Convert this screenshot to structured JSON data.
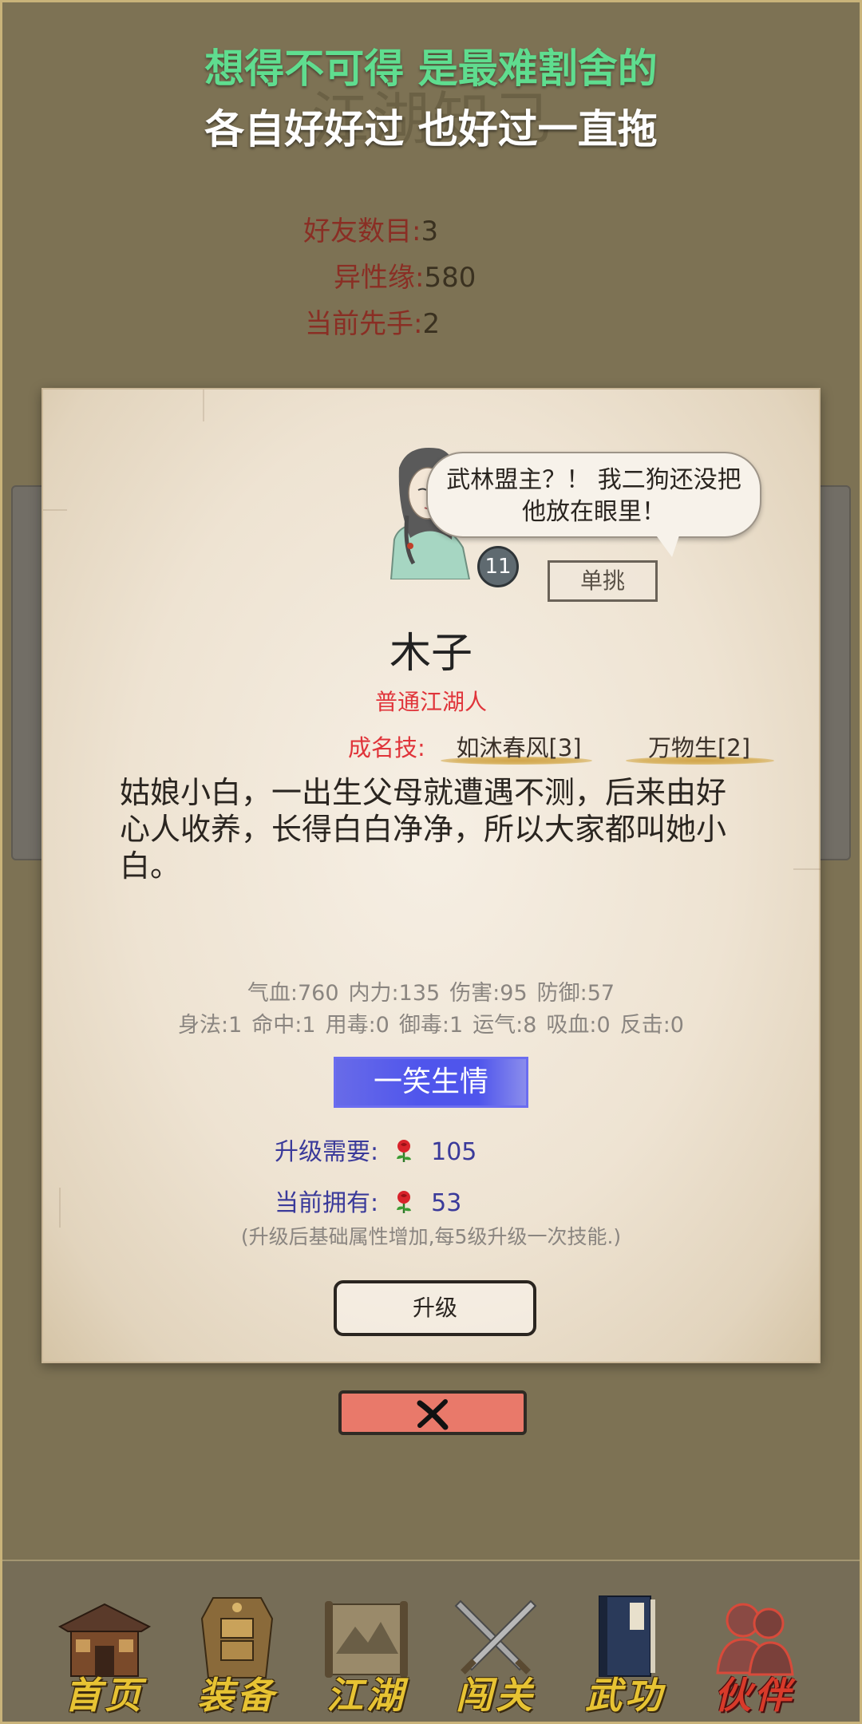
{
  "background_title": "江湖知己",
  "lyrics": {
    "line1": "想得不可得 是最难割舍的",
    "line2": "各自好好过 也好过一直拖"
  },
  "stats": [
    {
      "label": "好友数目:",
      "value": "3"
    },
    {
      "label": "异性缘:",
      "value": "580"
    },
    {
      "label": "当前先手:",
      "value": "2"
    }
  ],
  "companion": {
    "level": "11",
    "speech": "武林盟主？！ 我二狗还没把他放在眼里！",
    "duel_label": "单挑",
    "name": "木子",
    "rank": "普通江湖人",
    "signature_label": "成名技:",
    "skills": [
      "如沐春风[3]",
      "万物生[2]"
    ],
    "description": "姑娘小白，一出生父母就遭遇不测，后来由好心人收养，长得白白净净，所以大家都叫她小白。",
    "attrs_line1": [
      "气血:760",
      "内力:135",
      "伤害:95",
      "防御:57"
    ],
    "attrs_line2": [
      "身法:1",
      "命中:1",
      "用毒:0",
      "御毒:1",
      "运气:8",
      "吸血:0",
      "反击:0"
    ],
    "skill_button": "一笑生情",
    "upgrade_need_label": "升级需要:",
    "upgrade_need_value": "105",
    "owned_label": "当前拥有:",
    "owned_value": "53",
    "note": "(升级后基础属性增加,每5级升级一次技能.)",
    "upgrade_button": "升级"
  },
  "colors": {
    "accent_red": "#e0343a",
    "lyric_green": "#5fdd8f",
    "skill_blue": "#4f55ec",
    "close_red": "#e9796a",
    "nav_gold": "#e7c333"
  },
  "nav": [
    {
      "label": "首页",
      "icon": "house-icon",
      "active": false
    },
    {
      "label": "装备",
      "icon": "armor-icon",
      "active": false
    },
    {
      "label": "江湖",
      "icon": "scroll-map-icon",
      "active": false
    },
    {
      "label": "闯关",
      "icon": "crossed-swords-icon",
      "active": false
    },
    {
      "label": "武功",
      "icon": "book-icon",
      "active": false
    },
    {
      "label": "伙伴",
      "icon": "companions-icon",
      "active": true
    }
  ]
}
